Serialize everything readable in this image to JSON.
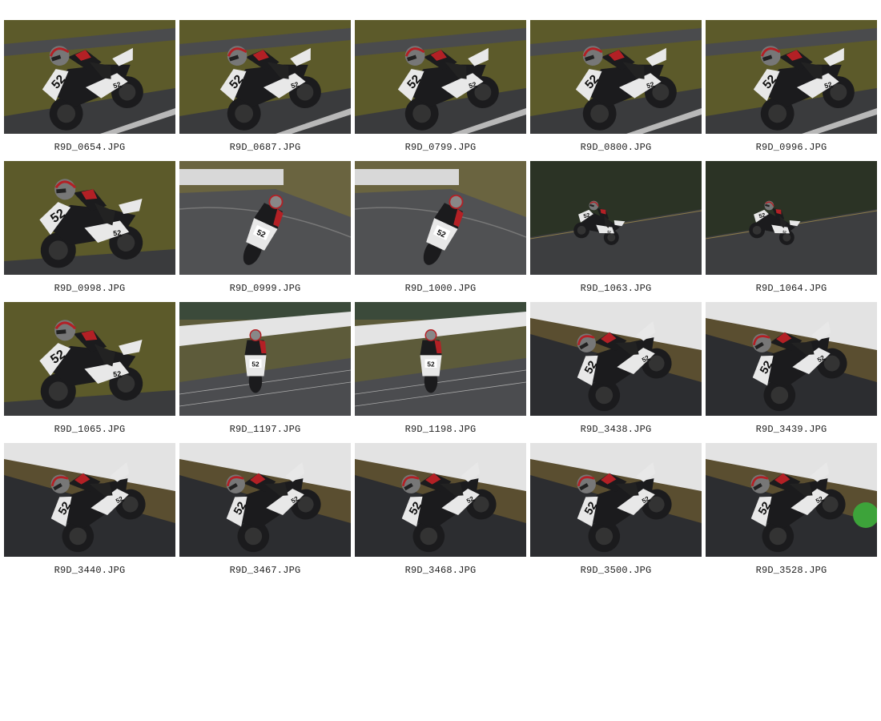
{
  "gallery": {
    "items": [
      {
        "filename": "R9D_0654.JPG",
        "scene": "rider-close-green"
      },
      {
        "filename": "R9D_0687.JPG",
        "scene": "rider-close-green"
      },
      {
        "filename": "R9D_0799.JPG",
        "scene": "rider-close-green"
      },
      {
        "filename": "R9D_0800.JPG",
        "scene": "rider-close-green"
      },
      {
        "filename": "R9D_0996.JPG",
        "scene": "rider-close-green"
      },
      {
        "filename": "R9D_0998.JPG",
        "scene": "rider-side-green"
      },
      {
        "filename": "R9D_0999.JPG",
        "scene": "rider-front-barrier"
      },
      {
        "filename": "R9D_1000.JPG",
        "scene": "rider-front-barrier"
      },
      {
        "filename": "R9D_1063.JPG",
        "scene": "rider-far-dark"
      },
      {
        "filename": "R9D_1064.JPG",
        "scene": "rider-far-dark"
      },
      {
        "filename": "R9D_1065.JPG",
        "scene": "rider-side-green"
      },
      {
        "filename": "R9D_1197.JPG",
        "scene": "rider-straight-fence"
      },
      {
        "filename": "R9D_1198.JPG",
        "scene": "rider-straight-fence"
      },
      {
        "filename": "R9D_3438.JPG",
        "scene": "rider-lean-dark"
      },
      {
        "filename": "R9D_3439.JPG",
        "scene": "rider-lean-dark"
      },
      {
        "filename": "R9D_3440.JPG",
        "scene": "rider-lean-dark"
      },
      {
        "filename": "R9D_3467.JPG",
        "scene": "rider-lean-dark"
      },
      {
        "filename": "R9D_3468.JPG",
        "scene": "rider-lean-dark"
      },
      {
        "filename": "R9D_3500.JPG",
        "scene": "rider-lean-dark"
      },
      {
        "filename": "R9D_3528.JPG",
        "scene": "rider-lean-dark-green"
      }
    ]
  },
  "colors": {
    "grass": "#5c5a2a",
    "asphalt": "#3a3b3d",
    "bike_white": "#e8e8e8",
    "bike_black": "#1b1b1d",
    "rider_red": "#b32025",
    "barrier": "#d8d8d8",
    "dark_bg": "#2b3325"
  },
  "bike_number": "52"
}
